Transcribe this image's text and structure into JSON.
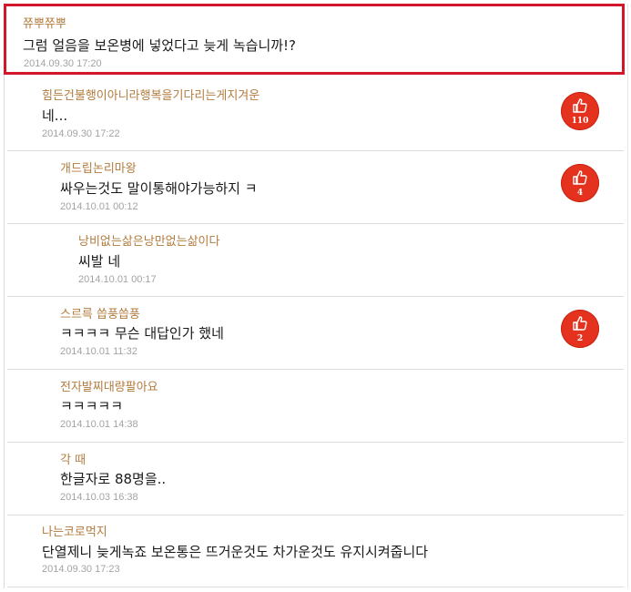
{
  "comments": [
    {
      "nick": "쮸뿌쮸뿌",
      "text": "그럼 얼음을 보온병에 넣었다고 늦게 녹습니까!?",
      "date": "2014.09.30 17:20"
    },
    {
      "nick": "힘든건불행이아니라행복을기다리는게지겨운",
      "text": "네...",
      "date": "2014.09.30 17:22",
      "likes": "110"
    },
    {
      "nick": "개드립논리마왕",
      "text": "싸우는것도 말이통해야가능하지 ㅋ",
      "date": "2014.10.01 00:12",
      "likes": "4"
    },
    {
      "nick": "낭비없는삶은낭만없는삶이다",
      "text": "씨발 네",
      "date": "2014.10.01 00:17"
    },
    {
      "nick": "스르륵 씁풍씁풍",
      "text": "ㅋㅋㅋㅋ 무슨 대답인가 했네",
      "date": "2014.10.01 11:32",
      "likes": "2"
    },
    {
      "nick": "전자발찌대량팔아요",
      "text": "ㅋㅋㅋㅋㅋ",
      "date": "2014.10.01 14:38"
    },
    {
      "nick": "각 때",
      "text": "한글자로 88명을..",
      "date": "2014.10.03 16:38"
    },
    {
      "nick": "나는코로먹지",
      "text": "단열제니 늦게녹죠 보온통은 뜨거운것도 차가운것도 유지시켜줍니다",
      "date": "2014.09.30 17:23"
    }
  ],
  "icons": {
    "like": "thumbs-up-icon"
  },
  "colors": {
    "highlight_border": "#d3172b",
    "nick": "#b27b3e",
    "like_badge": "#e4321e"
  }
}
